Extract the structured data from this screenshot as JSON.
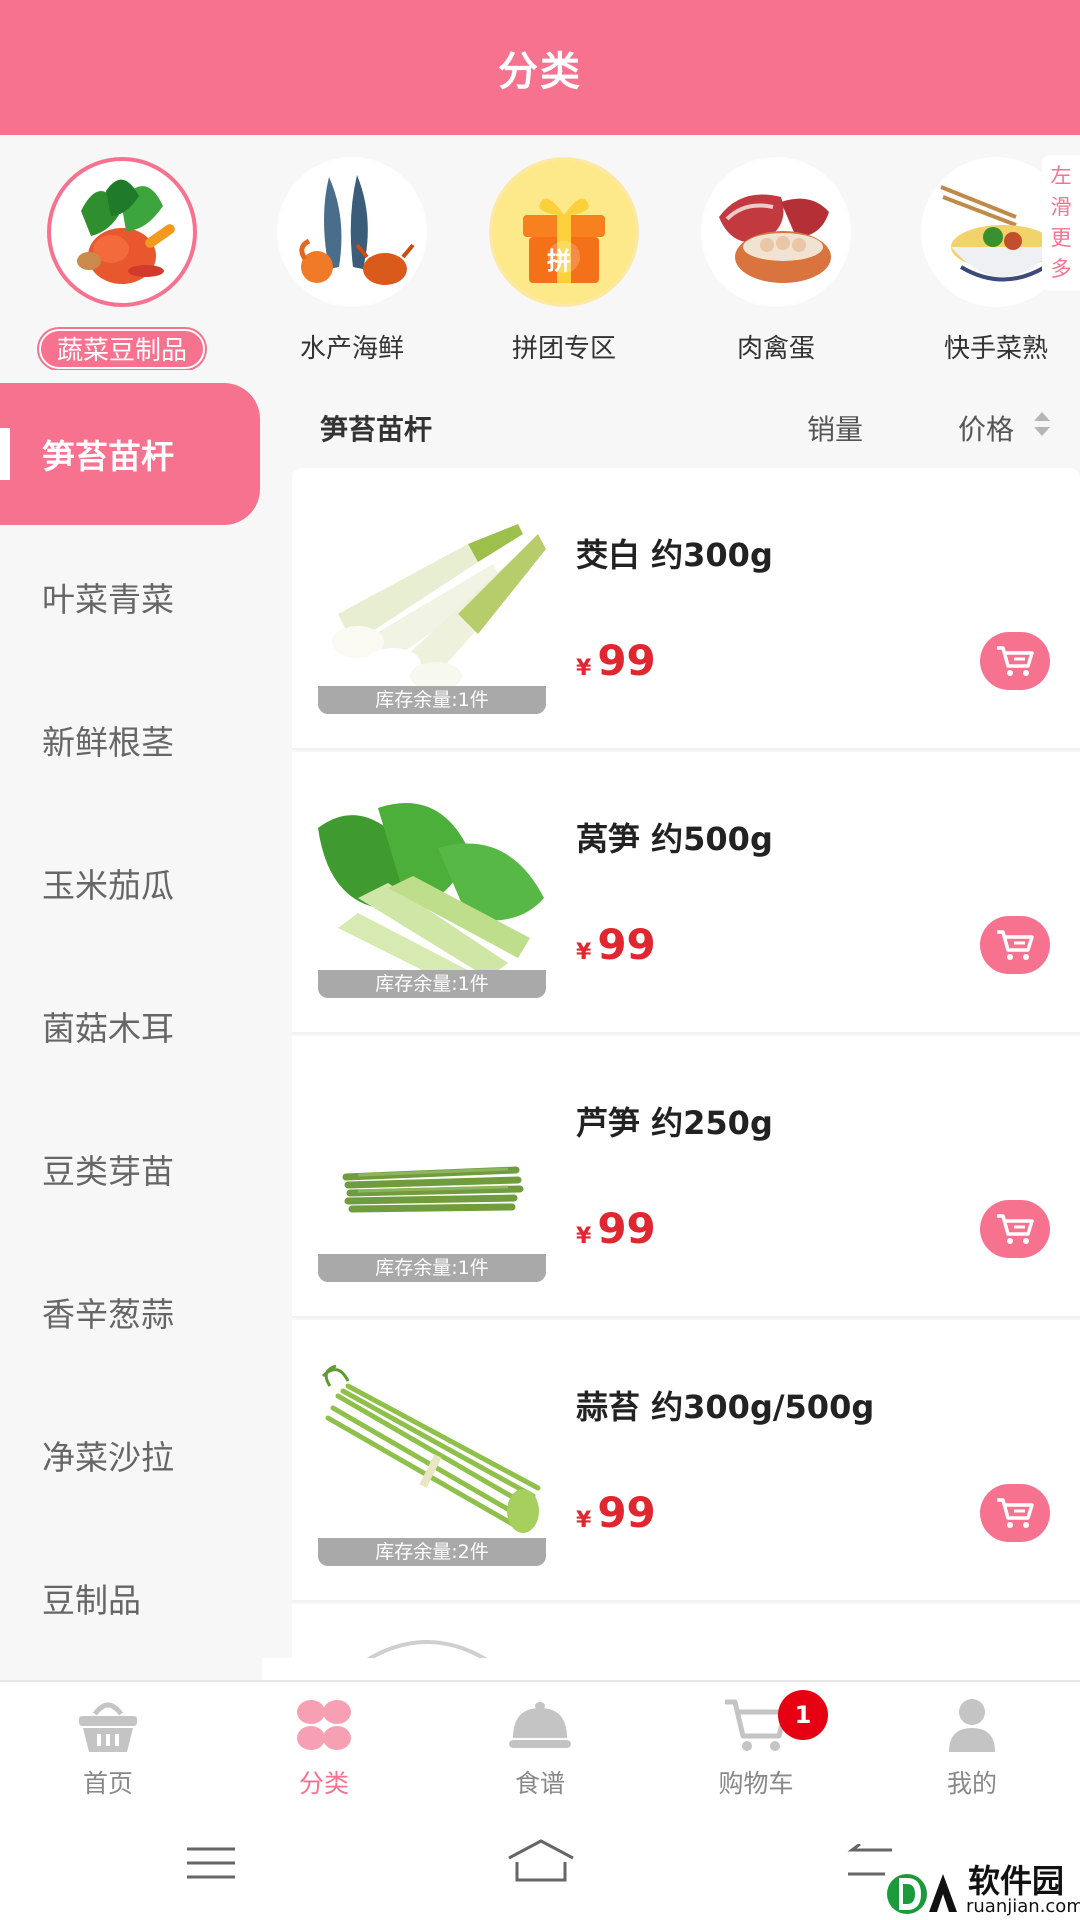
{
  "header": {
    "title": "分类"
  },
  "categories": [
    {
      "label": "蔬菜豆制品",
      "icon": "vegetables-icon",
      "active": true
    },
    {
      "label": "水产海鲜",
      "icon": "seafood-icon",
      "active": false
    },
    {
      "label": "拼团专区",
      "icon": "group-buy-gift-icon",
      "active": false
    },
    {
      "label": "肉禽蛋",
      "icon": "meat-eggs-icon",
      "active": false
    },
    {
      "label": "快手菜熟",
      "icon": "quick-dish-icon",
      "active": false
    }
  ],
  "group_buy_char": "拼",
  "slide_hint": "左滑更多",
  "sidebar": {
    "items": [
      "笋苔苗杆",
      "叶菜青菜",
      "新鲜根茎",
      "玉米茄瓜",
      "菌菇木耳",
      "豆类芽苗",
      "香辛葱蒜",
      "净菜沙拉",
      "豆制品"
    ],
    "active_index": 0
  },
  "list": {
    "title": "笋苔苗杆",
    "sort_sales": "销量",
    "sort_price": "价格"
  },
  "currency": "¥",
  "products": [
    {
      "name": "茭白 约300g",
      "price": "99",
      "stock": "库存余量:1件",
      "image": "water-bamboo"
    },
    {
      "name": "莴笋 约500g",
      "price": "99",
      "stock": "库存余量:1件",
      "image": "lettuce-stem"
    },
    {
      "name": "芦笋 约250g",
      "price": "99",
      "stock": "库存余量:1件",
      "image": "asparagus"
    },
    {
      "name": "蒜苔 约300g/500g",
      "price": "99",
      "stock": "库存余量:2件",
      "image": "garlic-scape"
    }
  ],
  "tabbar": {
    "tabs": [
      {
        "label": "首页",
        "icon": "basket-icon"
      },
      {
        "label": "分类",
        "icon": "category-grid-icon"
      },
      {
        "label": "食谱",
        "icon": "cloche-icon"
      },
      {
        "label": "购物车",
        "icon": "cart-icon"
      },
      {
        "label": "我的",
        "icon": "user-icon"
      }
    ],
    "active_index": 1,
    "cart_badge": "1"
  },
  "watermark": {
    "text": "软件园",
    "sub": "ruanjian.com",
    "logo": "DA"
  },
  "colors": {
    "brand_pink": "#f7728f",
    "price_red": "#e0262e",
    "badge_red": "#e60012"
  }
}
